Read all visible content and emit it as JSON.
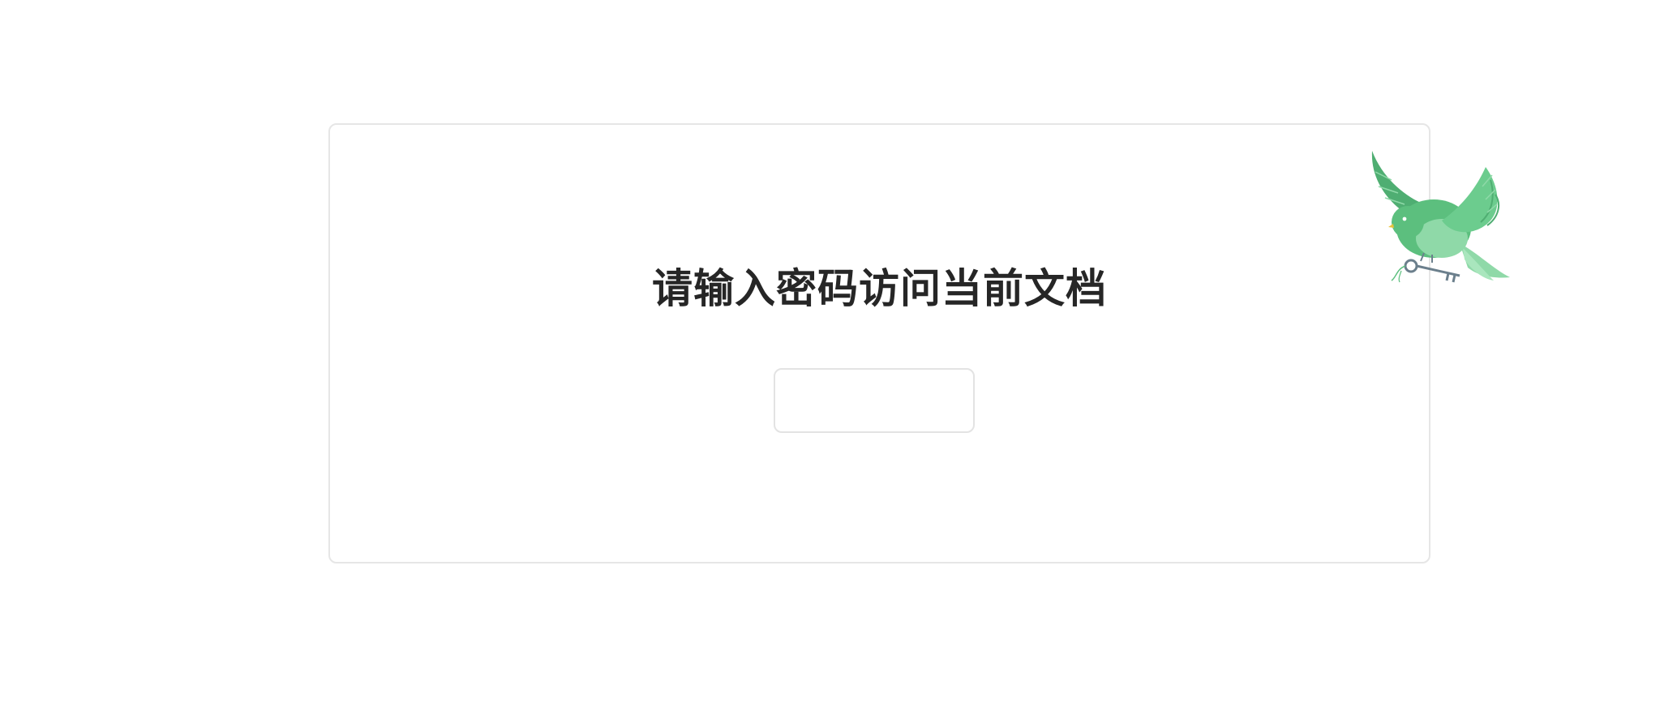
{
  "prompt": {
    "title": "请输入密码访问当前文档"
  },
  "password_field": {
    "value": "",
    "placeholder": ""
  },
  "illustration": {
    "icon": "bird-with-key-icon",
    "colors": {
      "bird": "#5cbf7e",
      "bird_light": "#8fd9a8",
      "bird_dark": "#3f9e63",
      "key": "#6b7f8c"
    }
  }
}
